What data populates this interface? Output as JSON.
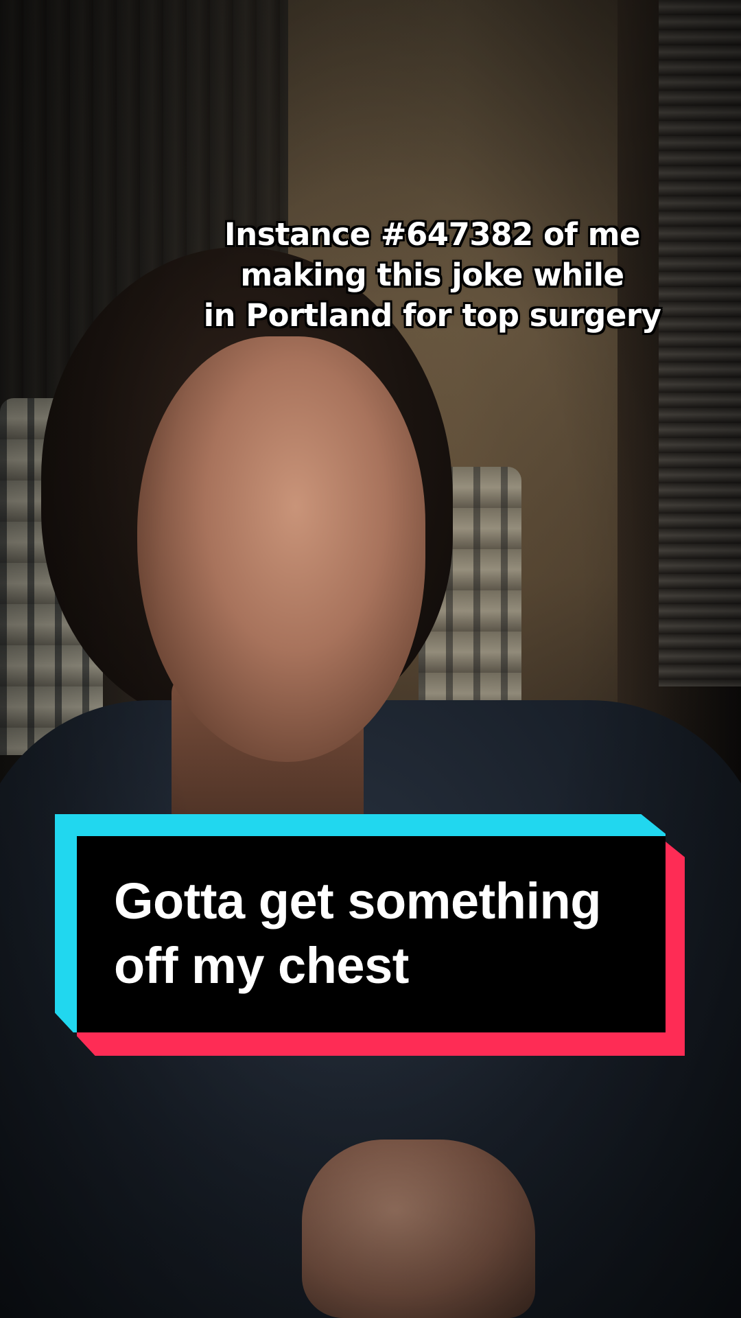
{
  "overlay_caption": {
    "lines": [
      "Instance #647382 of me",
      "making this joke while",
      "in Portland for top surgery"
    ]
  },
  "sticker_caption": {
    "lines": [
      "Gotta get something",
      "off my chest"
    ],
    "colors": {
      "accent_cyan": "#21d7ef",
      "accent_red": "#fe2c55",
      "box": "#000000",
      "text": "#ffffff"
    }
  },
  "video_frame": {
    "subject": "person-seated-in-dim-room-denim-jacket"
  }
}
